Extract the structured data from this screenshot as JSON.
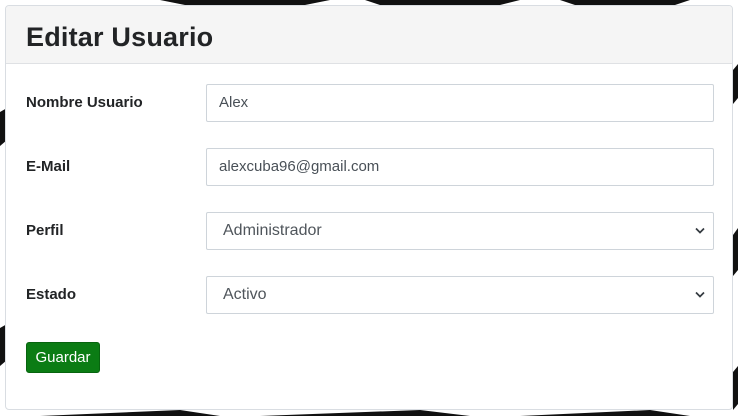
{
  "form": {
    "title": "Editar Usuario",
    "fields": {
      "username": {
        "label": "Nombre Usuario",
        "value": "Alex"
      },
      "email": {
        "label": "E-Mail",
        "value": "alexcuba96@gmail.com"
      },
      "profile": {
        "label": "Perfil",
        "value": "Administrador"
      },
      "status": {
        "label": "Estado",
        "value": "Activo"
      }
    },
    "submit_label": "Guardar"
  },
  "colors": {
    "submit_button": "#0b7c14",
    "header_background": "#f5f5f5",
    "input_border": "#ced4da"
  },
  "icons": {
    "select_arrow": "chevron-down-icon"
  }
}
